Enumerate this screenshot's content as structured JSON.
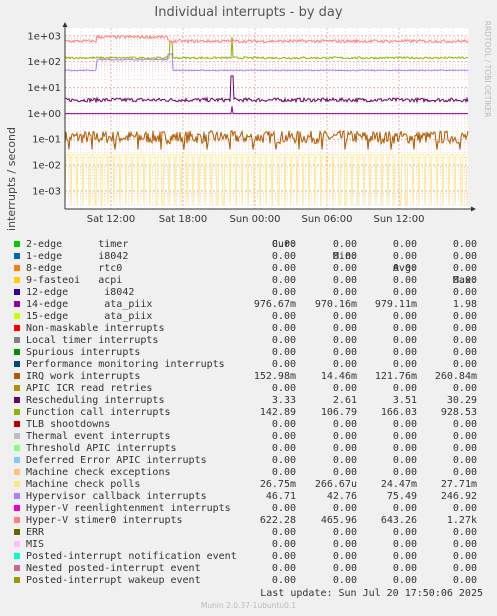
{
  "chart_data": {
    "type": "line",
    "title": "Individual interrupts - by day",
    "ylabel": "interrupts / second",
    "yscale": "log",
    "ylim": [
      0.0002,
      2000
    ],
    "y_ticks": [
      "1e+03",
      "1e+02",
      "1e+01",
      "1e+00",
      "1e-01",
      "1e-02",
      "1e-03"
    ],
    "x_ticks": [
      "Sat 12:00",
      "Sat 18:00",
      "Sun 00:00",
      "Sun 06:00",
      "Sun 12:00"
    ],
    "side_text": "RRDTOOL / TOBI OETIKER",
    "grid": true,
    "columns": [
      "Cur:",
      "Min:",
      "Avg:",
      "Max:"
    ],
    "series": [
      {
        "name": "2-edge      timer",
        "color": "#00cc00",
        "cur": "0.00",
        "min": "0.00",
        "avg": "0.00",
        "max": "0.00"
      },
      {
        "name": "1-edge      i8042",
        "color": "#0066b3",
        "cur": "0.00",
        "min": "0.00",
        "avg": "0.00",
        "max": "0.00"
      },
      {
        "name": "8-edge      rtc0",
        "color": "#ff8000",
        "cur": "0.00",
        "min": "0.00",
        "avg": "0.00",
        "max": "0.00"
      },
      {
        "name": "9-fasteoi   acpi",
        "color": "#ffcc00",
        "cur": "0.00",
        "min": "0.00",
        "avg": "0.00",
        "max": "0.00"
      },
      {
        "name": "12-edge      i8042",
        "color": "#330099",
        "cur": "0.00",
        "min": "0.00",
        "avg": "0.00",
        "max": "0.00"
      },
      {
        "name": "14-edge      ata_piix",
        "color": "#990099",
        "cur": "976.67m",
        "min": "970.16m",
        "avg": "979.11m",
        "max": "1.98"
      },
      {
        "name": "15-edge      ata_piix",
        "color": "#ccff00",
        "cur": "0.00",
        "min": "0.00",
        "avg": "0.00",
        "max": "0.00"
      },
      {
        "name": "Non-maskable interrupts",
        "color": "#ff0000",
        "cur": "0.00",
        "min": "0.00",
        "avg": "0.00",
        "max": "0.00"
      },
      {
        "name": "Local timer interrupts",
        "color": "#808080",
        "cur": "0.00",
        "min": "0.00",
        "avg": "0.00",
        "max": "0.00"
      },
      {
        "name": "Spurious interrupts",
        "color": "#008f00",
        "cur": "0.00",
        "min": "0.00",
        "avg": "0.00",
        "max": "0.00"
      },
      {
        "name": "Performance monitoring interrupts",
        "color": "#00487d",
        "cur": "0.00",
        "min": "0.00",
        "avg": "0.00",
        "max": "0.00"
      },
      {
        "name": "IRQ work interrupts",
        "color": "#b35a00",
        "cur": "152.98m",
        "min": "14.46m",
        "avg": "121.76m",
        "max": "260.84m"
      },
      {
        "name": "APIC ICR read retries",
        "color": "#b38f00",
        "cur": "0.00",
        "min": "0.00",
        "avg": "0.00",
        "max": "0.00"
      },
      {
        "name": "Rescheduling interrupts",
        "color": "#6b006b",
        "cur": "3.33",
        "min": "2.61",
        "avg": "3.51",
        "max": "30.29"
      },
      {
        "name": "Function call interrupts",
        "color": "#8fb300",
        "cur": "142.89",
        "min": "106.79",
        "avg": "166.03",
        "max": "928.53"
      },
      {
        "name": "TLB shootdowns",
        "color": "#b30000",
        "cur": "0.00",
        "min": "0.00",
        "avg": "0.00",
        "max": "0.00"
      },
      {
        "name": "Thermal event interrupts",
        "color": "#bebebe",
        "cur": "0.00",
        "min": "0.00",
        "avg": "0.00",
        "max": "0.00"
      },
      {
        "name": "Threshold APIC interrupts",
        "color": "#80ff80",
        "cur": "0.00",
        "min": "0.00",
        "avg": "0.00",
        "max": "0.00"
      },
      {
        "name": "Deferred Error APIC interrupts",
        "color": "#80c9ff",
        "cur": "0.00",
        "min": "0.00",
        "avg": "0.00",
        "max": "0.00"
      },
      {
        "name": "Machine check exceptions",
        "color": "#ffc080",
        "cur": "0.00",
        "min": "0.00",
        "avg": "0.00",
        "max": "0.00"
      },
      {
        "name": "Machine check polls",
        "color": "#ffe680",
        "cur": "26.75m",
        "min": "266.67u",
        "avg": "24.47m",
        "max": "27.71m"
      },
      {
        "name": "Hypervisor callback interrupts",
        "color": "#aa80ff",
        "cur": "46.71",
        "min": "42.76",
        "avg": "75.49",
        "max": "246.92"
      },
      {
        "name": "Hyper-V reenlightenment interrupts",
        "color": "#ee00cc",
        "cur": "0.00",
        "min": "0.00",
        "avg": "0.00",
        "max": "0.00"
      },
      {
        "name": "Hyper-V stimer0 interrupts",
        "color": "#ff8080",
        "cur": "622.28",
        "min": "465.96",
        "avg": "643.26",
        "max": "1.27k"
      },
      {
        "name": "ERR",
        "color": "#666600",
        "cur": "0.00",
        "min": "0.00",
        "avg": "0.00",
        "max": "0.00"
      },
      {
        "name": "MIS",
        "color": "#ffbfff",
        "cur": "0.00",
        "min": "0.00",
        "avg": "0.00",
        "max": "0.00"
      },
      {
        "name": "Posted-interrupt notification event",
        "color": "#00ffcc",
        "cur": "0.00",
        "min": "0.00",
        "avg": "0.00",
        "max": "0.00"
      },
      {
        "name": "Nested posted-interrupt event",
        "color": "#cc6699",
        "cur": "0.00",
        "min": "0.00",
        "avg": "0.00",
        "max": "0.00"
      },
      {
        "name": "Posted-interrupt wakeup event",
        "color": "#999900",
        "cur": "0.00",
        "min": "0.00",
        "avg": "0.00",
        "max": "0.00"
      }
    ]
  },
  "last_update": "Last update: Sun Jul 20 17:50:06 2025",
  "footer": "Munin 2.0.37-1ubuntu0.1"
}
